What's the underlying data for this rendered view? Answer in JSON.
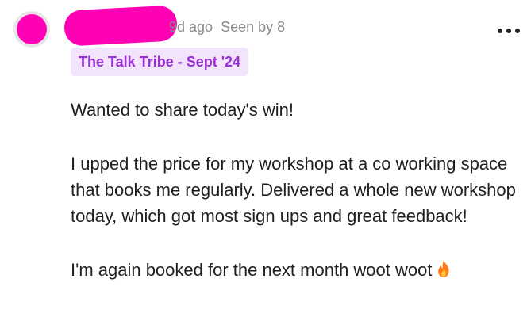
{
  "post": {
    "time_ago": "9d ago",
    "seen_by": "Seen by 8",
    "tag": "The Talk Tribe - Sept '24",
    "paragraphs": [
      "Wanted to share today's win!",
      "I upped the price for my workshop at a co working space that books me regularly. Delivered a whole new workshop today, which got most sign ups and great feedback!",
      "I'm again booked for the next month woot woot"
    ],
    "emoji": "fire-icon"
  },
  "colors": {
    "redaction": "#ff00b4",
    "tag_bg": "#f1e4fb",
    "tag_text": "#9a2fd7",
    "meta_text": "#8a8a8a"
  }
}
